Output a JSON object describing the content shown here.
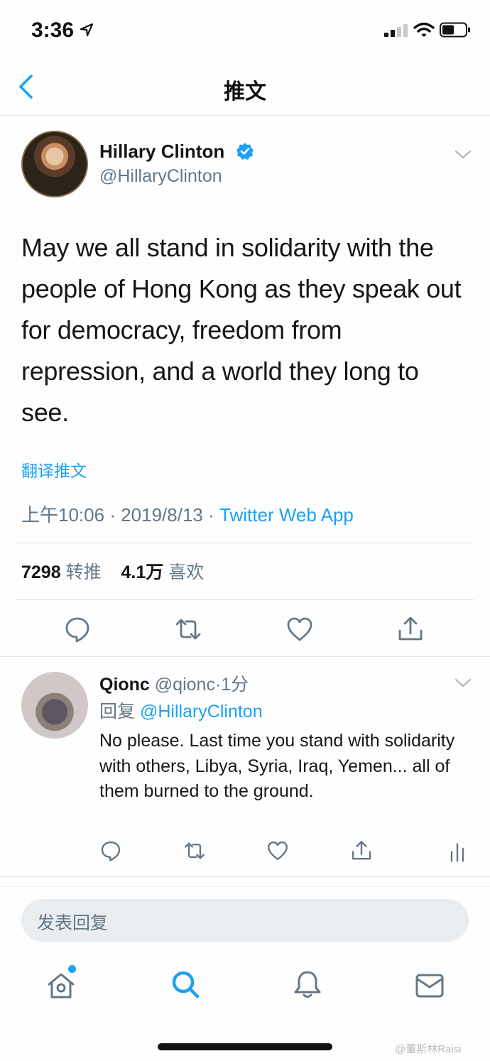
{
  "status_bar": {
    "time": "3:36"
  },
  "nav": {
    "title": "推文"
  },
  "tweet": {
    "author_name": "Hillary Clinton",
    "handle": "@HillaryClinton",
    "text": "May we all stand in solidarity with the people of Hong Kong as they speak out for democracy, freedom from repression, and a world they long to see.",
    "translate_label": "翻译推文",
    "time": "上午10:06",
    "date": "2019/8/13",
    "separator": "·",
    "source": "Twitter Web App",
    "retweets": "7298",
    "retweets_label": "转推",
    "likes": "4.1万",
    "likes_label": "喜欢"
  },
  "reply": {
    "author_name": "Qionc",
    "handle": "@qionc",
    "separator": "·",
    "time": "1分",
    "reply_prefix": "回复",
    "reply_to": "@HillaryClinton",
    "text": "No please. Last time you stand with solidarity with others, Libya, Syria, Iraq, Yemen... all of them burned to the ground."
  },
  "compose": {
    "placeholder": "发表回复"
  },
  "watermark": "@董斯林Raisi",
  "colors": {
    "accent": "#1da1f2",
    "secondary_text": "#657786",
    "divider": "#e3e7ea"
  }
}
